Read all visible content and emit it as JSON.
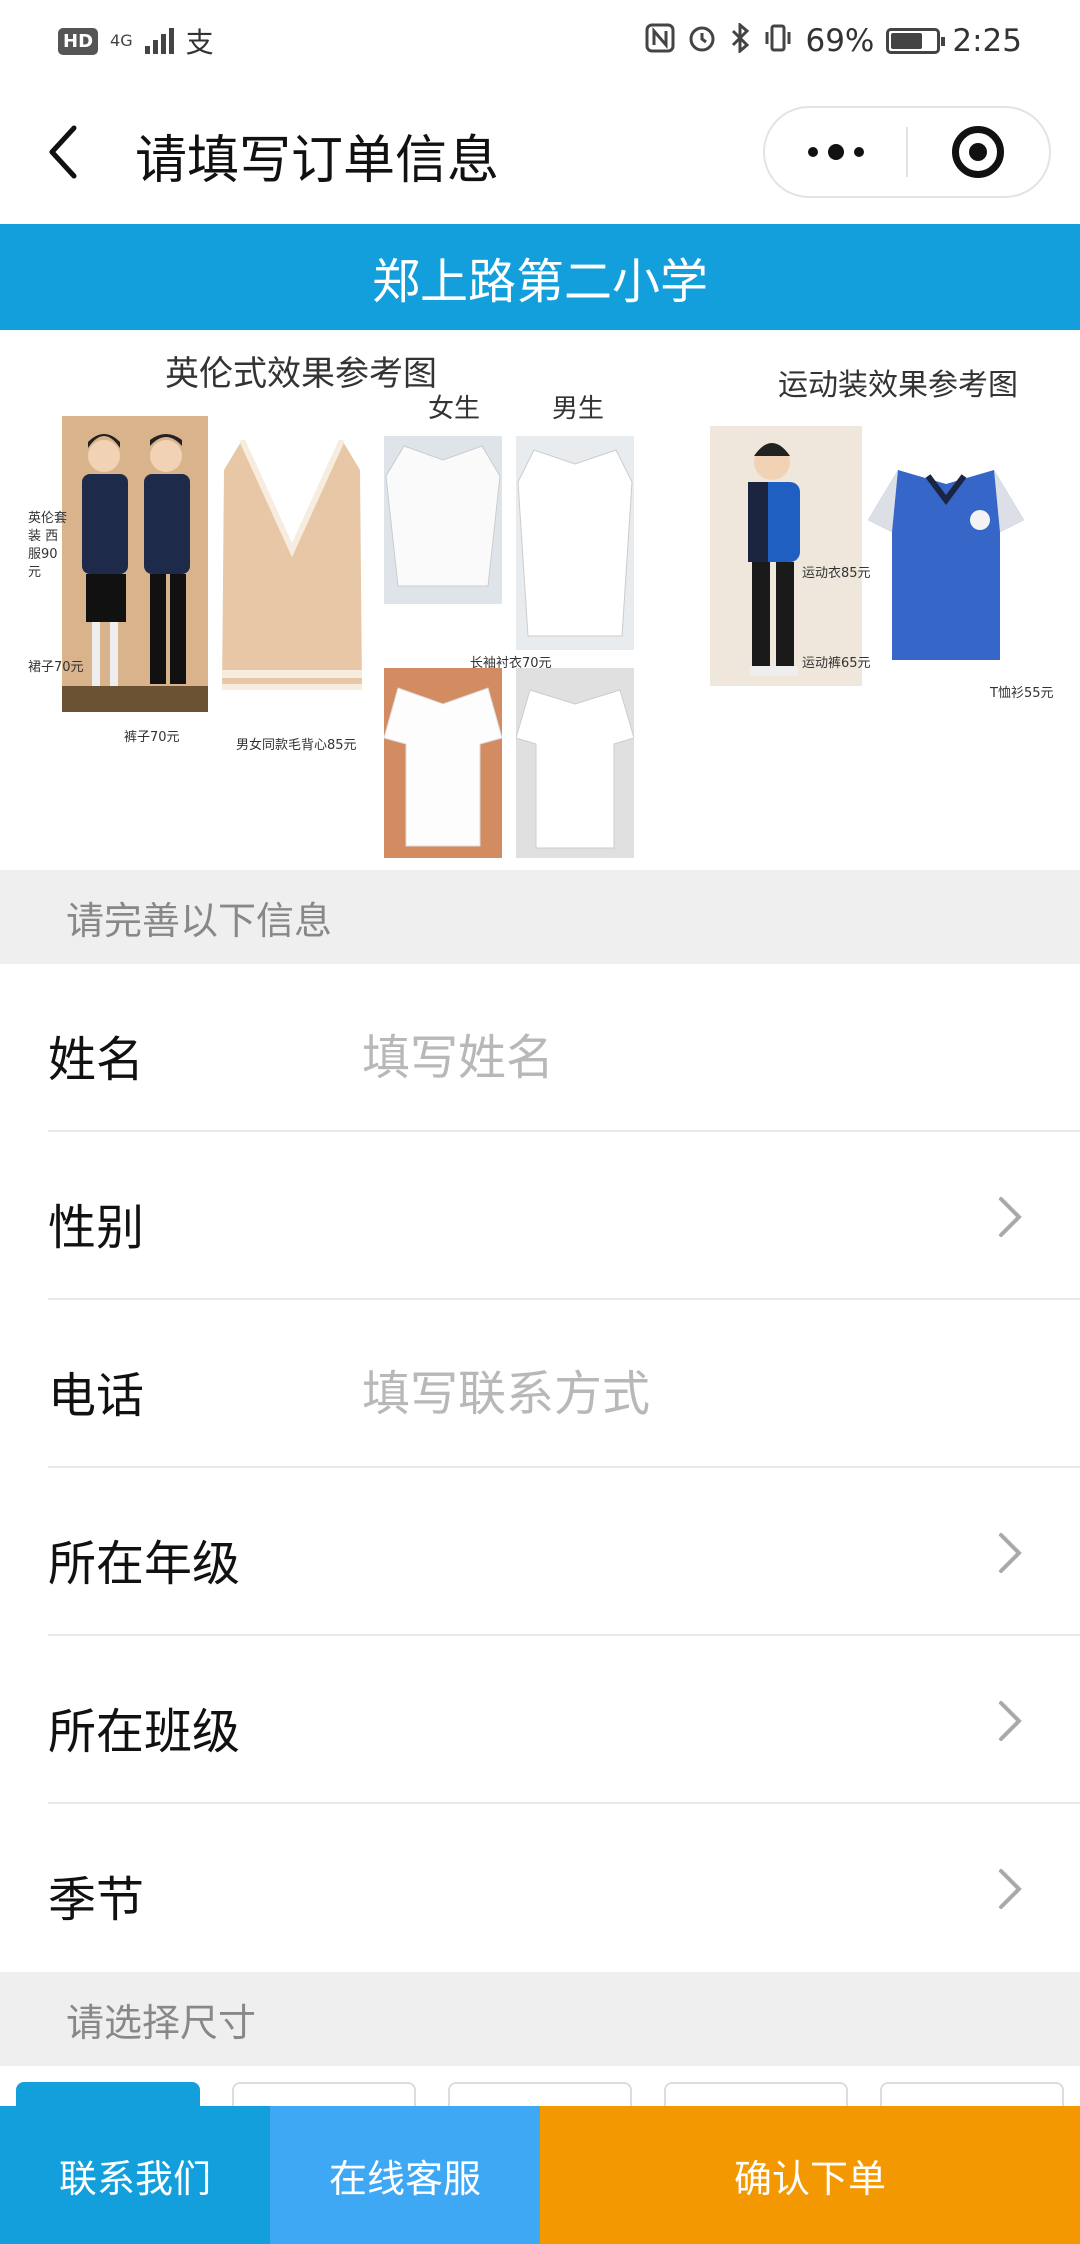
{
  "status_bar": {
    "hd": "HD",
    "network": "4G",
    "pay_icon": "支",
    "battery_percent": "69%",
    "battery_level": 0.69,
    "time": "2:25"
  },
  "nav": {
    "title": "请填写订单信息"
  },
  "banner": {
    "school": "郑上路第二小学"
  },
  "reference_image": {
    "caption_left": "英伦式效果参考图",
    "caption_right": "运动装效果参考图",
    "label_girl": "女生",
    "label_boy": "男生",
    "note_suit": "英伦套装 西服90元",
    "note_skirt": "裙子70元",
    "note_pants": "裤子70元",
    "note_vest": "男女同款毛背心85元",
    "note_shirt": "长袖衬衣70元",
    "note_sport_top": "运动衣85元",
    "note_sport_pants": "运动裤65元",
    "note_tshirt": "T恤衫55元"
  },
  "section_info": {
    "title": "请完善以下信息"
  },
  "form": {
    "name": {
      "label": "姓名",
      "placeholder": "填写姓名"
    },
    "gender": {
      "label": "性别"
    },
    "phone": {
      "label": "电话",
      "placeholder": "填写联系方式"
    },
    "grade": {
      "label": "所在年级"
    },
    "class": {
      "label": "所在班级"
    },
    "season": {
      "label": "季节"
    }
  },
  "section_size": {
    "title": "请选择尺寸"
  },
  "bottom_bar": {
    "contact": "联系我们",
    "service": "在线客服",
    "confirm": "确认下单"
  },
  "colors": {
    "brand_blue": "#129fdc",
    "service_blue": "#3ea8f4",
    "confirm_orange": "#f39800"
  }
}
